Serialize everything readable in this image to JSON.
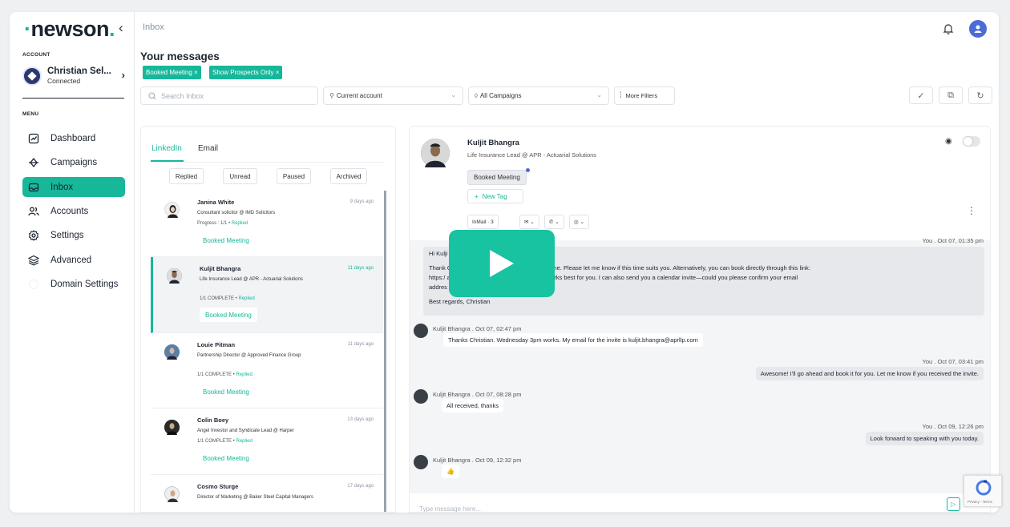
{
  "brand": {
    "name": "newson",
    "accent": "#17b79a"
  },
  "breadcrumb": "Inbox",
  "sidebar": {
    "account_label": "ACCOUNT",
    "account_name": "Christian Sel...",
    "account_status": "Connected",
    "menu_label": "MENU",
    "items": [
      {
        "label": "Dashboard",
        "icon": "dashboard-icon"
      },
      {
        "label": "Campaigns",
        "icon": "campaigns-icon"
      },
      {
        "label": "Inbox",
        "icon": "inbox-icon",
        "active": true
      },
      {
        "label": "Accounts",
        "icon": "accounts-icon"
      },
      {
        "label": "Settings",
        "icon": "settings-icon"
      },
      {
        "label": "Advanced",
        "icon": "layers-icon"
      },
      {
        "label": "Domain Settings",
        "icon": "domain-icon"
      }
    ]
  },
  "page": {
    "title": "Your messages",
    "chips": [
      "Booked Meeting ×",
      "Show Prospects Only ×"
    ]
  },
  "filters": {
    "search_placeholder": "Search Inbox",
    "account_select": "Current account",
    "campaign_select": "All Campaigns",
    "more_filters": "More Filters"
  },
  "list": {
    "tabs": [
      "LinkedIn",
      "Email"
    ],
    "filters": [
      "Replied",
      "Unread",
      "Paused",
      "Archived"
    ],
    "conversations": [
      {
        "name": "Janina White",
        "role": "Consultant solicitor @ IMD Solicitors",
        "progress": "Progress : 1/1 •",
        "progress_status": "Replied",
        "time": "9 days ago",
        "tag": "Booked Meeting"
      },
      {
        "name": "Kuljit Bhangra",
        "role": "Life Insurance Lead @ APR - Actuarial Solutions",
        "progress": "1/1 COMPLETE •",
        "progress_status": "Replied",
        "time": "11 days ago",
        "tag": "Booked Meeting"
      },
      {
        "name": "Louie Pitman",
        "role": "Partnership Director @ Approved Finance Group",
        "progress": "1/1 COMPLETE •",
        "progress_status": "Replied",
        "time": "11 days ago",
        "tag": "Booked Meeting"
      },
      {
        "name": "Colin Boey",
        "role": "Angel Investor and Syndicate Lead @ Harper",
        "progress": "1/1 COMPLETE •",
        "progress_status": "Replied",
        "time": "13 days ago",
        "tag": "Booked Meeting"
      },
      {
        "name": "Cosmo Sturge",
        "role": "Director of Marketing @ Baker Steel Capital Managers",
        "progress": "",
        "progress_status": "",
        "time": "17 days ago",
        "tag": ""
      }
    ]
  },
  "conversation": {
    "name": "Kuljit Bhangra",
    "role": "Life Insurance Lead @ APR - Actuarial Solutions",
    "tag": "Booked Meeting",
    "new_tag": "New Tag",
    "channels": [
      "InMail · 3",
      "✉ ⌄",
      "✆ ⌄",
      "◎ ⌄"
    ],
    "first_meta": "You . Oct 07, 01:35 pm",
    "first_message": [
      "Hi Kulji",
      "Thank                                                          October 9th at 3 PM UK time works for me. Please let me know if this time suits you. Alternatively, you can book directly through this link:",
      "https:/                                                         ancial-planning to choose a time that works best for you. I can also send you a calendar invite—could you please confirm your email",
      "addres",
      "Best regards, Christian"
    ],
    "messages": [
      {
        "from": "them",
        "meta": "Kuljit Bhangra . Oct 07, 02:47 pm",
        "text": "Thanks Christian. Wednesday 3pm works. My email for the invite is kuljit.bhangra@aprllp.com"
      },
      {
        "from": "me",
        "meta": "You . Oct 07, 03:41 pm",
        "text": "Awesome! I'll go ahead and book it for you. Let me know if you received the invite."
      },
      {
        "from": "them",
        "meta": "Kuljit Bhangra . Oct 07, 08:28 pm",
        "text": "All received, thanks"
      },
      {
        "from": "me",
        "meta": "You . Oct 09, 12:26 pm",
        "text": "Look forward to speaking with you today."
      },
      {
        "from": "them",
        "meta": "Kuljit Bhangra . Oct 09, 12:32 pm",
        "text": "👍"
      }
    ],
    "compose_placeholder": "Type message here..."
  },
  "recaptcha": {
    "text": "Privacy - Terms"
  }
}
